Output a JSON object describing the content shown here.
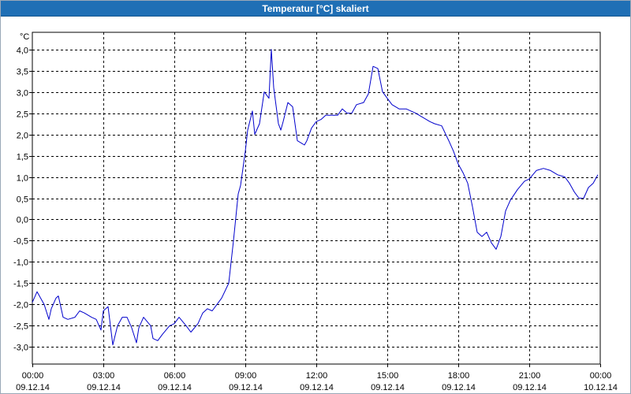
{
  "window": {
    "title": "Temperatur [°C] skaliert"
  },
  "chart_data": {
    "type": "line",
    "ylabel": "°C",
    "ylim": [
      -3.4,
      4.4
    ],
    "yticks": [
      "4,0",
      "3,5",
      "3,0",
      "2,5",
      "2,0",
      "1,5",
      "1,0",
      "0,5",
      "0,0",
      "-0,5",
      "-1,0",
      "-1,5",
      "-2,0",
      "-2,5",
      "-3,0"
    ],
    "ytick_values": [
      4.0,
      3.5,
      3.0,
      2.5,
      2.0,
      1.5,
      1.0,
      0.5,
      0.0,
      -0.5,
      -1.0,
      -1.5,
      -2.0,
      -2.5,
      -3.0
    ],
    "xlim": [
      "09.12.14 00:00",
      "10.12.14 00:00"
    ],
    "xticks": [
      {
        "time": "00:00",
        "date": "09.12.14"
      },
      {
        "time": "03:00",
        "date": "09.12.14"
      },
      {
        "time": "06:00",
        "date": "09.12.14"
      },
      {
        "time": "09:00",
        "date": "09.12.14"
      },
      {
        "time": "12:00",
        "date": "09.12.14"
      },
      {
        "time": "15:00",
        "date": "09.12.14"
      },
      {
        "time": "18:00",
        "date": "09.12.14"
      },
      {
        "time": "21:00",
        "date": "09.12.14"
      },
      {
        "time": "00:00",
        "date": "10.12.14"
      }
    ],
    "grid": true,
    "line_color": "#0000cc",
    "series": [
      {
        "x_hours": [
          0,
          0.2,
          0.5,
          0.7,
          0.8,
          1.0,
          1.1,
          1.3,
          1.5,
          1.8,
          2.0,
          2.2,
          2.5,
          2.7,
          2.9,
          3.0,
          3.2,
          3.4,
          3.6,
          3.8,
          4.0,
          4.2,
          4.4,
          4.5,
          4.7,
          5.0,
          5.1,
          5.3,
          5.5,
          5.8,
          6.0,
          6.2,
          6.5,
          6.7,
          7.0,
          7.2,
          7.4,
          7.6,
          7.8,
          8.0,
          8.3,
          8.5,
          8.7,
          8.8,
          9.0,
          9.1,
          9.3,
          9.4,
          9.6,
          9.8,
          10.0,
          10.1,
          10.2,
          10.4,
          10.5,
          10.6,
          10.8,
          11.0,
          11.2,
          11.5,
          11.6,
          11.8,
          12.0,
          12.2,
          12.4,
          12.6,
          12.9,
          13.1,
          13.3,
          13.5,
          13.7,
          14.0,
          14.2,
          14.4,
          14.6,
          14.8,
          15.0,
          15.2,
          15.5,
          15.8,
          16.0,
          16.2,
          16.5,
          16.8,
          17.0,
          17.3,
          17.6,
          17.8,
          18.0,
          18.2,
          18.4,
          18.6,
          18.8,
          19.0,
          19.2,
          19.4,
          19.6,
          19.8,
          20.0,
          20.2,
          20.5,
          20.8,
          21.0,
          21.3,
          21.6,
          21.9,
          22.2,
          22.5,
          22.7,
          22.9,
          23.1,
          23.3,
          23.5,
          23.7,
          23.9
        ],
        "y": [
          -1.95,
          -1.7,
          -2.0,
          -2.35,
          -2.1,
          -1.85,
          -1.8,
          -2.3,
          -2.35,
          -2.3,
          -2.15,
          -2.2,
          -2.3,
          -2.35,
          -2.6,
          -2.15,
          -2.05,
          -2.95,
          -2.5,
          -2.3,
          -2.3,
          -2.55,
          -2.9,
          -2.55,
          -2.3,
          -2.5,
          -2.8,
          -2.85,
          -2.7,
          -2.5,
          -2.45,
          -2.3,
          -2.5,
          -2.65,
          -2.45,
          -2.2,
          -2.1,
          -2.15,
          -2.0,
          -1.85,
          -1.5,
          -0.5,
          0.6,
          0.8,
          1.6,
          2.1,
          2.55,
          2.0,
          2.25,
          3.0,
          2.85,
          4.0,
          3.1,
          2.25,
          2.1,
          2.3,
          2.75,
          2.65,
          1.85,
          1.75,
          1.85,
          2.15,
          2.3,
          2.35,
          2.45,
          2.45,
          2.45,
          2.6,
          2.5,
          2.5,
          2.7,
          2.75,
          2.95,
          3.6,
          3.55,
          3.0,
          2.85,
          2.7,
          2.6,
          2.6,
          2.55,
          2.5,
          2.4,
          2.3,
          2.25,
          2.2,
          1.85,
          1.6,
          1.3,
          1.1,
          0.85,
          0.3,
          -0.3,
          -0.4,
          -0.3,
          -0.55,
          -0.7,
          -0.4,
          0.2,
          0.45,
          0.7,
          0.9,
          0.95,
          1.15,
          1.2,
          1.15,
          1.05,
          1.0,
          0.85,
          0.65,
          0.5,
          0.5,
          0.75,
          0.85,
          1.05
        ]
      }
    ]
  }
}
